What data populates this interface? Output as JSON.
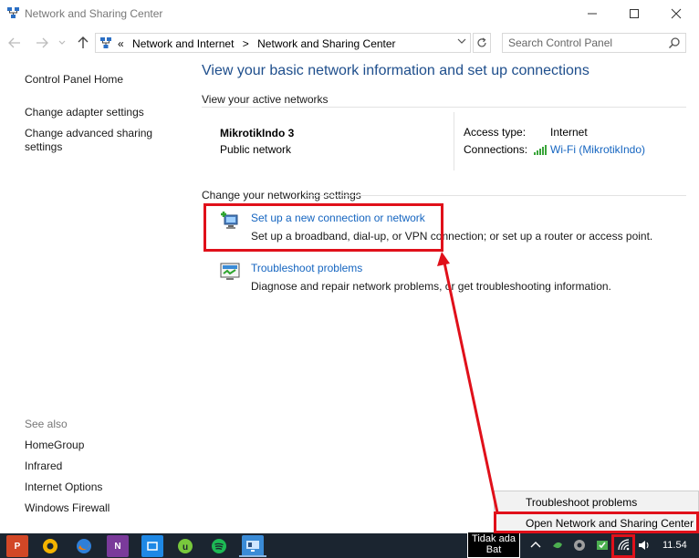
{
  "window": {
    "title": "Network and Sharing Center",
    "minimize_icon": "minimize-icon",
    "maximize_icon": "maximize-icon",
    "close_icon": "close-icon"
  },
  "address_bar": {
    "overflow": "«",
    "breadcrumbs": [
      "Network and Internet",
      "Network and Sharing Center"
    ],
    "separator": ">",
    "search_placeholder": "Search Control Panel"
  },
  "sidebar": {
    "links": [
      "Control Panel Home",
      "Change adapter settings",
      "Change advanced sharing settings"
    ],
    "see_also_label": "See also",
    "see_also": [
      "HomeGroup",
      "Infrared",
      "Internet Options",
      "Windows Firewall"
    ]
  },
  "main": {
    "heading": "View your basic network information and set up connections",
    "active_networks_label": "View your active networks",
    "network": {
      "name": "MikrotikIndo  3",
      "category": "Public network",
      "access_type_label": "Access type:",
      "access_type": "Internet",
      "connections_label": "Connections:",
      "connection": "Wi-Fi (MikrotikIndo)"
    },
    "change_settings_label": "Change your networking settings",
    "tasks": [
      {
        "link": "Set up a new connection or network",
        "desc": "Set up a broadband, dial-up, or VPN connection; or set up a router or access point.",
        "icon": "new-connection-icon"
      },
      {
        "link": "Troubleshoot problems",
        "desc": "Diagnose and repair network problems, or get troubleshooting information.",
        "icon": "troubleshoot-icon"
      }
    ]
  },
  "tray_menu": {
    "items": [
      "Troubleshoot problems",
      "Open Network and Sharing Center"
    ]
  },
  "taskbar": {
    "apps": [
      "powerpoint",
      "chrome-canary",
      "firefox",
      "onenote",
      "maxthon",
      "utorrent",
      "spotify",
      "control-panel"
    ],
    "battery_tooltip": "Tidak ada Bat",
    "clock": "11.54"
  },
  "colors": {
    "link": "#1565c0",
    "heading": "#1e4e8c",
    "annotation": "#e0101a",
    "taskbar": "#1b2530"
  }
}
